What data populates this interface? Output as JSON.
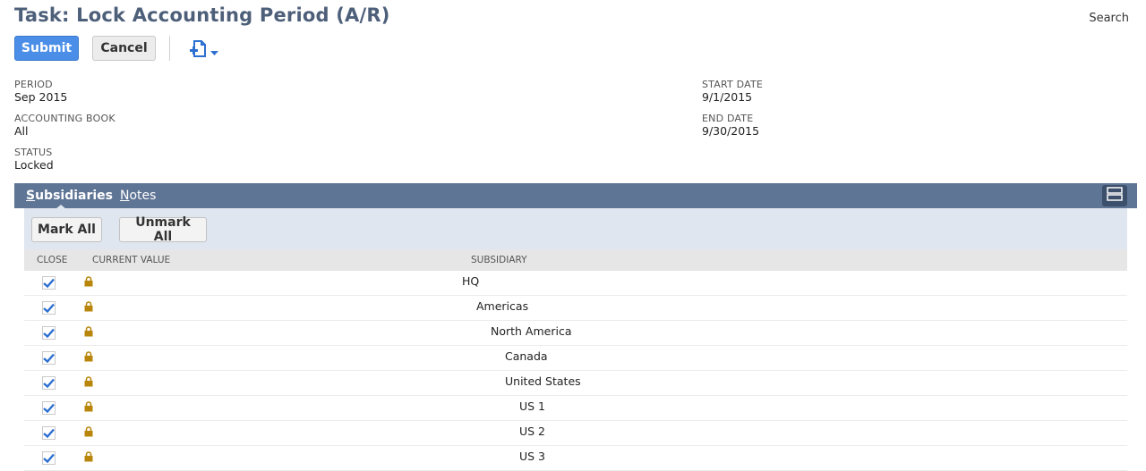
{
  "page": {
    "title": "Task: Lock Accounting Period (A/R)",
    "search_label": "Search"
  },
  "toolbar": {
    "submit_label": "Submit",
    "cancel_label": "Cancel"
  },
  "fields": {
    "period": {
      "label": "PERIOD",
      "value": "Sep 2015"
    },
    "accounting_book": {
      "label": "ACCOUNTING BOOK",
      "value": "All"
    },
    "status": {
      "label": "STATUS",
      "value": "Locked"
    },
    "start_date": {
      "label": "START DATE",
      "value": "9/1/2015"
    },
    "end_date": {
      "label": "END DATE",
      "value": "9/30/2015"
    }
  },
  "tabs": [
    {
      "first": "S",
      "rest": "ubsidiaries",
      "active": true
    },
    {
      "first": "N",
      "rest": "otes",
      "active": false
    }
  ],
  "subtab": {
    "mark_all_label": "Mark All",
    "unmark_all_label": "Unmark All"
  },
  "table": {
    "columns": [
      "CLOSE",
      "CURRENT VALUE",
      "SUBSIDIARY"
    ],
    "rows": [
      {
        "close": true,
        "subsidiary": "HQ",
        "level": 0
      },
      {
        "close": true,
        "subsidiary": "Americas",
        "level": 1
      },
      {
        "close": true,
        "subsidiary": "North America",
        "level": 2
      },
      {
        "close": true,
        "subsidiary": "Canada",
        "level": 3
      },
      {
        "close": true,
        "subsidiary": "United States",
        "level": 3
      },
      {
        "close": true,
        "subsidiary": "US 1",
        "level": 4
      },
      {
        "close": true,
        "subsidiary": "US 2",
        "level": 4
      },
      {
        "close": true,
        "subsidiary": "US 3",
        "level": 4
      }
    ]
  },
  "colors": {
    "title": "#4d5f79",
    "primary": "#4a8ee8",
    "tabbar": "#5f7596",
    "panel": "#dfe6ef",
    "check": "#2c6fd1",
    "lock": "#b8860b"
  },
  "icons": {
    "print": "print-icon",
    "lock": "lock-icon",
    "check": "checkmark-icon",
    "layout": "layout-icon"
  }
}
